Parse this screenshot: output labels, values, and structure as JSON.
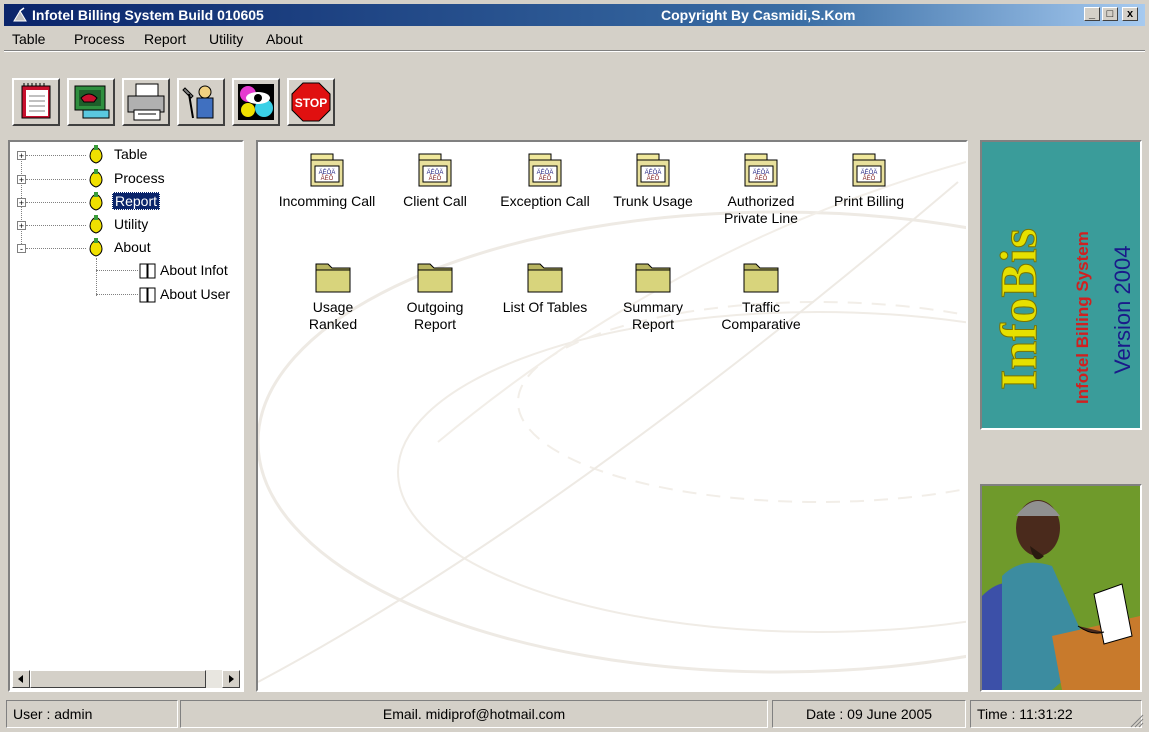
{
  "window": {
    "title": "Infotel Billing System  Build 010605",
    "copyright": "Copyright By Casmidi,S.Kom",
    "minimize": "_",
    "maximize": "□",
    "close": "x"
  },
  "menu": [
    {
      "label": "Table"
    },
    {
      "label": "Process"
    },
    {
      "label": "Report"
    },
    {
      "label": "Utility"
    },
    {
      "label": "About"
    }
  ],
  "toolbar": [
    {
      "icon": "notebook-icon"
    },
    {
      "icon": "telephone-computer-icon"
    },
    {
      "icon": "printer-icon"
    },
    {
      "icon": "tools-icon"
    },
    {
      "icon": "colorful-eye-icon"
    },
    {
      "icon": "stop-sign-icon",
      "text": "STOP"
    }
  ],
  "tree": {
    "nodes": [
      {
        "label": "Table",
        "expander": "+"
      },
      {
        "label": "Process",
        "expander": "+"
      },
      {
        "label": "Report",
        "expander": "+"
      },
      {
        "label": "Utility",
        "expander": "+"
      },
      {
        "label": "About",
        "expander": "-"
      }
    ],
    "children": [
      {
        "label": "About Infot"
      },
      {
        "label": "About User"
      }
    ]
  },
  "icons": {
    "row1": [
      {
        "label": "Incomming Call"
      },
      {
        "label": "Client Call"
      },
      {
        "label": "Exception Call"
      },
      {
        "label": "Trunk Usage"
      },
      {
        "label": "Authorized Private Line"
      },
      {
        "label": "Print Billing"
      }
    ],
    "row2": [
      {
        "label": "Usage Ranked"
      },
      {
        "label": "Outgoing Report"
      },
      {
        "label": "List Of Tables"
      },
      {
        "label": "Summary Report"
      },
      {
        "label": "Traffic Comparative"
      }
    ]
  },
  "brand": {
    "logo": "InfoBis",
    "subtitle": "Infotel Billing System",
    "version": "Version 2004"
  },
  "status": {
    "user": "User : admin",
    "email": "Email. midiprof@hotmail.com",
    "date": "Date : 09 June 2005",
    "time": "Time : 11:31:22"
  },
  "colors": {
    "titlebar": "#0a246a",
    "brand_bg": "#3a9c9a",
    "logo_yellow": "#e6e000",
    "subtitle_red": "#d02020",
    "version_blue": "#1a1a8a"
  }
}
